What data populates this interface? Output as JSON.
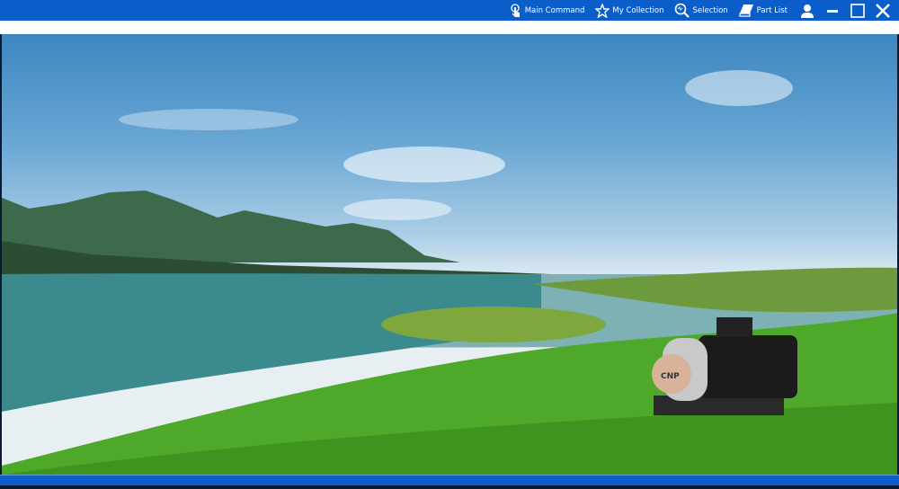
{
  "titlebar": {
    "menu": [
      {
        "label": "Main Command",
        "icon": "touch-icon"
      },
      {
        "label": "My Collection",
        "icon": "star-icon"
      },
      {
        "label": "Selection",
        "icon": "search-icon"
      },
      {
        "label": "Part List",
        "icon": "book-icon"
      }
    ]
  },
  "scene": {
    "pump_brand": "CNP"
  },
  "colors": {
    "bar": "#0b5ec9"
  }
}
